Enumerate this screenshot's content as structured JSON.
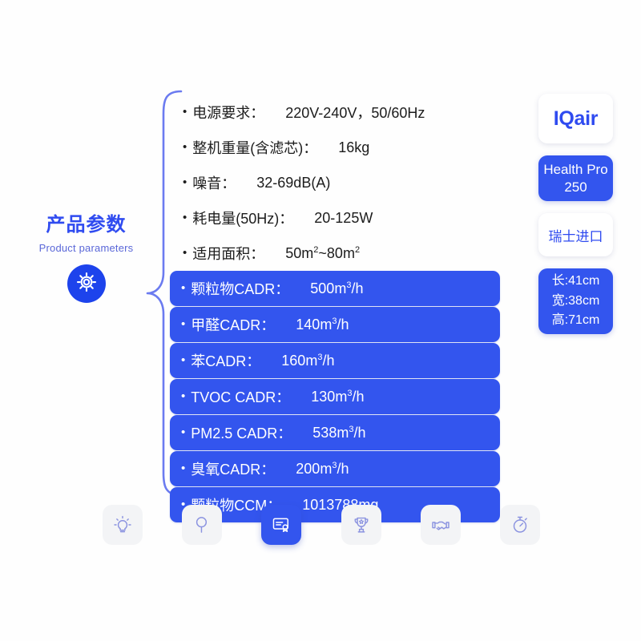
{
  "section": {
    "title_cn": "产品参数",
    "title_en": "Product parameters",
    "badge_icon": "gear-icon"
  },
  "specs": [
    {
      "label": "电源要求：",
      "value": "220V-240V，50/60Hz",
      "highlighted": false
    },
    {
      "label": "整机重量(含滤芯)：",
      "value": "16kg",
      "highlighted": false
    },
    {
      "label": "噪音：",
      "value": "32-69dB(A)",
      "highlighted": false
    },
    {
      "label": "耗电量(50Hz)：",
      "value": "20-125W",
      "highlighted": false
    },
    {
      "label": "适用面积：",
      "value": "50m²~80m²",
      "highlighted": false
    },
    {
      "label": "颗粒物CADR：",
      "value": "500m³/h",
      "highlighted": true
    },
    {
      "label": "甲醛CADR：",
      "value": "140m³/h",
      "highlighted": true
    },
    {
      "label": "苯CADR：",
      "value": "160m³/h",
      "highlighted": true
    },
    {
      "label": "TVOC CADR：",
      "value": "130m³/h",
      "highlighted": true
    },
    {
      "label": "PM2.5 CADR：",
      "value": "538m³/h",
      "highlighted": true
    },
    {
      "label": "臭氧CADR：",
      "value": "200m³/h",
      "highlighted": true
    },
    {
      "label": "颗粒物CCM：",
      "value": "1013788mg",
      "highlighted": true
    }
  ],
  "product_cards": {
    "brand": "IQair",
    "model_line1": "Health Pro",
    "model_line2": "250",
    "origin": "瑞士进口",
    "dimensions": {
      "length": "长:41cm",
      "width": "宽:38cm",
      "height": "高:71cm"
    }
  },
  "icon_bar": [
    {
      "name": "lightbulb-icon",
      "active": false
    },
    {
      "name": "magnifier-icon",
      "active": false
    },
    {
      "name": "certificate-icon",
      "active": true
    },
    {
      "name": "trophy-icon",
      "active": false
    },
    {
      "name": "handshake-icon",
      "active": false
    },
    {
      "name": "stopwatch-icon",
      "active": false
    }
  ],
  "colors": {
    "accent_blue": "#3355EE",
    "label_blue": "#2F4BF0",
    "subtitle_blue": "#5A67D8",
    "tile_grey": "#F3F4F6",
    "brace_blue": "#6B7BF0"
  }
}
